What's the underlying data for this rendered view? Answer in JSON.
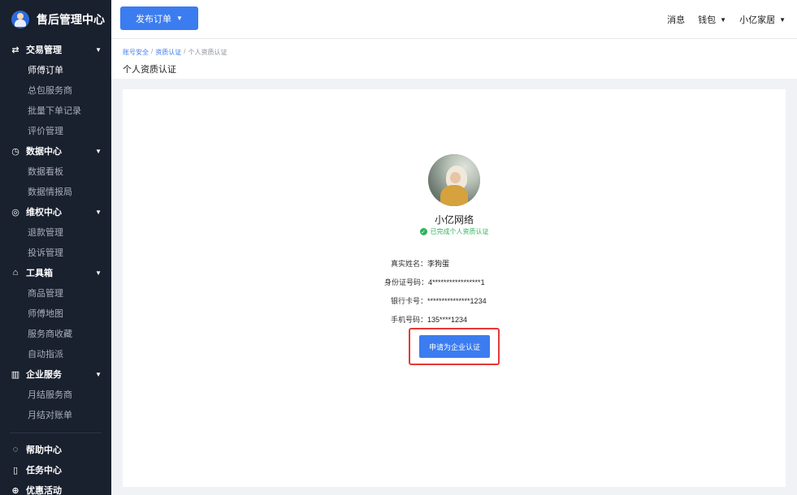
{
  "app": {
    "title": "售后管理中心"
  },
  "sidebar": {
    "groups": [
      {
        "icon": "swap-icon",
        "label": "交易管理",
        "items": [
          "师傅订单",
          "总包服务商",
          "批量下单记录",
          "评价管理"
        ]
      },
      {
        "icon": "clock-icon",
        "label": "数据中心",
        "items": [
          "数据看板",
          "数据情报局"
        ]
      },
      {
        "icon": "shield-check-icon",
        "label": "维权中心",
        "items": [
          "退款管理",
          "投诉管理"
        ]
      },
      {
        "icon": "toolbox-icon",
        "label": "工具箱",
        "items": [
          "商品管理",
          "师傅地图",
          "服务商收藏",
          "自动指派"
        ]
      },
      {
        "icon": "enterprise-icon",
        "label": "企业服务",
        "items": [
          "月结服务商",
          "月结对账单"
        ]
      }
    ],
    "bottom": [
      {
        "icon": "help-icon",
        "label": "帮助中心"
      },
      {
        "icon": "task-icon",
        "label": "任务中心"
      },
      {
        "icon": "gift-icon",
        "label": "优惠活动"
      }
    ]
  },
  "topbar": {
    "publish_label": "发布订单",
    "messages": "消息",
    "wallet": "钱包",
    "user": "小亿家居"
  },
  "breadcrumb": {
    "items": [
      "账号安全",
      "资质认证",
      "个人资质认证"
    ],
    "title": "个人资质认证"
  },
  "profile": {
    "name": "小亿网络",
    "verified_text": "已完成个人资质认证",
    "fields": [
      {
        "label": "真实姓名：",
        "value": "李狗蛋"
      },
      {
        "label": "身份证号码：",
        "value": "4*****************1"
      },
      {
        "label": "银行卡号：",
        "value": "***************1234"
      },
      {
        "label": "手机号码：",
        "value": "135****1234"
      }
    ],
    "apply_label": "申请为企业认证"
  },
  "colors": {
    "sidebar_bg": "#19202e",
    "primary": "#3b7cf0",
    "success": "#2db35a",
    "highlight": "#e53935"
  }
}
